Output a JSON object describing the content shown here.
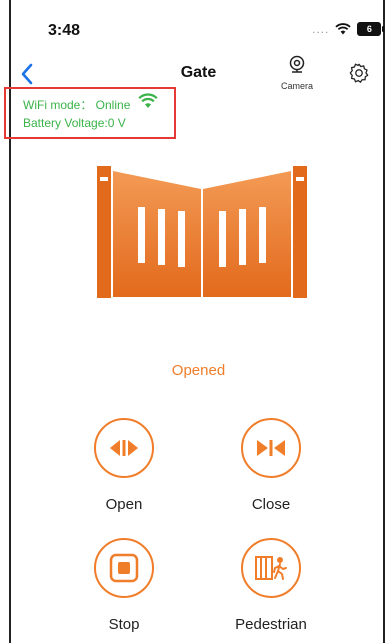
{
  "status_bar": {
    "time": "3:48",
    "signal": "....",
    "battery": "6"
  },
  "nav": {
    "title": "Gate",
    "camera_label": "Camera"
  },
  "device_info": {
    "wifi_mode": "WiFi mode： Online",
    "battery_voltage": "Battery Voltage:0 V"
  },
  "gate": {
    "status": "Opened"
  },
  "controls": {
    "open": "Open",
    "close": "Close",
    "stop": "Stop",
    "pedestrian": "Pedestrian"
  },
  "colors": {
    "accent": "#f07d2a",
    "online": "#3bb34a",
    "highlight": "#e53935",
    "nav_back": "#1a73e8"
  },
  "icons": [
    "wifi-icon",
    "battery-icon",
    "back-chevron-icon",
    "camera-icon",
    "gear-icon",
    "wifi-online-icon",
    "gate-icon",
    "open-icon",
    "close-icon",
    "stop-icon",
    "pedestrian-icon"
  ]
}
